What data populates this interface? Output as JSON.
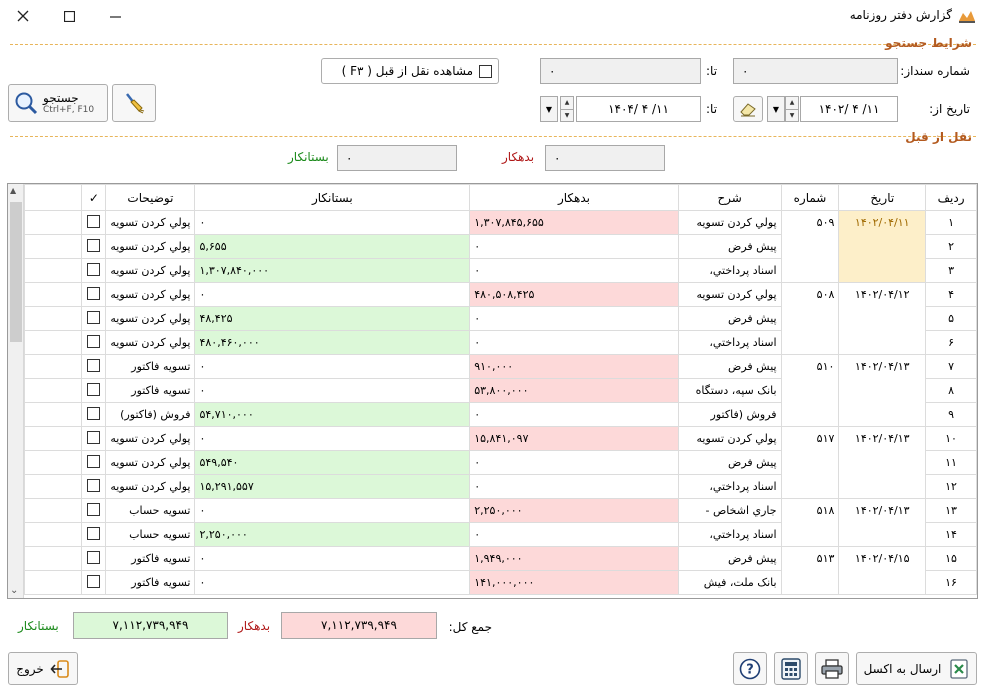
{
  "window": {
    "title": "گزارش دفتر روزنامه"
  },
  "search": {
    "section_title": "شرایط جستجو",
    "doc_no_label": "شماره سنداز:",
    "doc_no_from": "۰",
    "to_label": "تا:",
    "doc_no_to": "۰",
    "carry_label": "مشاهده نقل از قبل ( F۳ )",
    "date_from_label": "تاریخ از:",
    "date_from": "۱۴۰۲/ ۴ /۱۱",
    "date_to_label": "تا:",
    "date_to": "۱۴۰۴/ ۴ /۱۱",
    "search_button": "جستجو",
    "search_shortcut": "Ctrl+F, F10"
  },
  "carry": {
    "section_title": "نقل از قبل",
    "debit_label": "بدهکار",
    "debit_value": "۰",
    "credit_label": "بستانکار",
    "credit_value": "۰"
  },
  "table": {
    "headers": {
      "row": "ردیف",
      "date": "تاریخ",
      "number": "شماره",
      "desc": "شرح",
      "debit": "بدهکار",
      "credit": "بستانکار",
      "notes": "توضیحات",
      "check": "✓"
    },
    "groups": [
      {
        "date": "۱۴۰۲/۰۴/۱۱",
        "number": "۵۰۹",
        "highlight": true,
        "rows": [
          {
            "row": "۱",
            "desc": "پولي كردن تسويه",
            "debit": "۱,۳۰۷,۸۴۵,۶۵۵",
            "credit": "۰",
            "notes": "پولي كردن تسويه"
          },
          {
            "row": "۲",
            "desc": "پيش فرض",
            "debit": "۰",
            "credit": "۵,۶۵۵",
            "notes": "پولي كردن تسويه"
          },
          {
            "row": "۳",
            "desc": "اسناد پرداختي،",
            "debit": "۰",
            "credit": "۱,۳۰۷,۸۴۰,۰۰۰",
            "notes": "پولي كردن تسويه"
          }
        ]
      },
      {
        "date": "۱۴۰۲/۰۴/۱۲",
        "number": "۵۰۸",
        "highlight": false,
        "rows": [
          {
            "row": "۴",
            "desc": "پولي كردن تسويه",
            "debit": "۴۸۰,۵۰۸,۴۲۵",
            "credit": "۰",
            "notes": "پولي كردن تسويه"
          },
          {
            "row": "۵",
            "desc": "پيش فرض",
            "debit": "۰",
            "credit": "۴۸,۴۲۵",
            "notes": "پولي كردن تسويه"
          },
          {
            "row": "۶",
            "desc": "اسناد پرداختي،",
            "debit": "۰",
            "credit": "۴۸۰,۴۶۰,۰۰۰",
            "notes": "پولي كردن تسويه"
          }
        ]
      },
      {
        "date": "۱۴۰۲/۰۴/۱۳",
        "number": "۵۱۰",
        "highlight": false,
        "rows": [
          {
            "row": "۷",
            "desc": "پيش فرض",
            "debit": "۹۱۰,۰۰۰",
            "credit": "۰",
            "notes": "تسويه فاكتور"
          },
          {
            "row": "۸",
            "desc": "بانک سپه، دستگاه",
            "debit": "۵۳,۸۰۰,۰۰۰",
            "credit": "۰",
            "notes": "تسويه فاكتور"
          },
          {
            "row": "۹",
            "desc": "فروش (فاكتور",
            "debit": "۰",
            "credit": "۵۴,۷۱۰,۰۰۰",
            "notes": "فروش (فاكتور)"
          }
        ]
      },
      {
        "date": "۱۴۰۲/۰۴/۱۳",
        "number": "۵۱۷",
        "highlight": false,
        "rows": [
          {
            "row": "۱۰",
            "desc": "پولي كردن تسويه",
            "debit": "۱۵,۸۴۱,۰۹۷",
            "credit": "۰",
            "notes": "پولي كردن تسويه"
          },
          {
            "row": "۱۱",
            "desc": "پيش فرض",
            "debit": "۰",
            "credit": "۵۴۹,۵۴۰",
            "notes": "پولي كردن تسويه"
          },
          {
            "row": "۱۲",
            "desc": "اسناد پرداختي،",
            "debit": "۰",
            "credit": "۱۵,۲۹۱,۵۵۷",
            "notes": "پولي كردن تسويه"
          }
        ]
      },
      {
        "date": "۱۴۰۲/۰۴/۱۳",
        "number": "۵۱۸",
        "highlight": false,
        "rows": [
          {
            "row": "۱۳",
            "desc": "جاري اشخاص -",
            "debit": "۲,۲۵۰,۰۰۰",
            "credit": "۰",
            "notes": "تسويه حساب"
          },
          {
            "row": "۱۴",
            "desc": "اسناد پرداختي،",
            "debit": "۰",
            "credit": "۲,۲۵۰,۰۰۰",
            "notes": "تسويه حساب"
          }
        ]
      },
      {
        "date": "۱۴۰۲/۰۴/۱۵",
        "number": "۵۱۳",
        "highlight": false,
        "rows": [
          {
            "row": "۱۵",
            "desc": "پيش فرض",
            "debit": "۱,۹۴۹,۰۰۰",
            "credit": "۰",
            "notes": "تسويه فاكتور"
          },
          {
            "row": "۱۶",
            "desc": "بانک ملت، فيش",
            "debit": "۱۴۱,۰۰۰,۰۰۰",
            "credit": "۰",
            "notes": "تسويه فاكتور"
          }
        ]
      }
    ]
  },
  "totals": {
    "label": "جمع کل:",
    "debit_label": "بدهکار",
    "debit_value": "۷,۱۱۲,۷۳۹,۹۴۹",
    "credit_label": "بستانکار",
    "credit_value": "۷,۱۱۲,۷۳۹,۹۴۹"
  },
  "footer": {
    "exit_label": "خروج",
    "excel_label": "ارسال به اکسل"
  },
  "colors": {
    "debit_bg": "#fdd9d9",
    "credit_bg": "#dcf8d8",
    "section": "#b35a1f",
    "highlight": "#fdefc9"
  }
}
